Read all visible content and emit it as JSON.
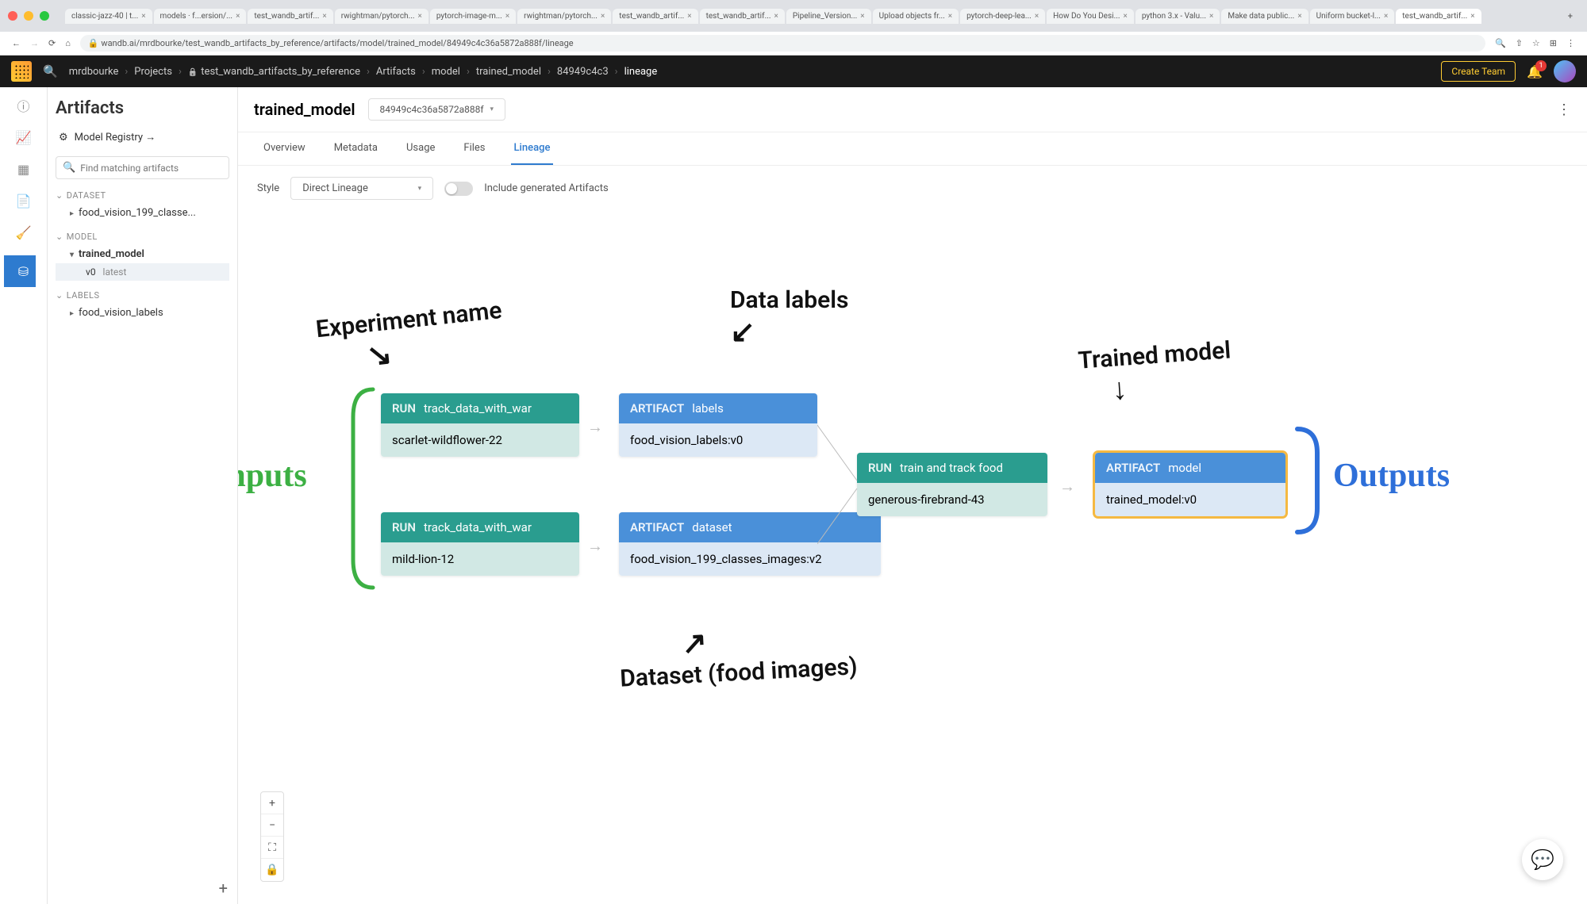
{
  "browser": {
    "tabs": [
      {
        "label": "classic-jazz-40 | t..."
      },
      {
        "label": "models · f...ersion/..."
      },
      {
        "label": "test_wandb_artif..."
      },
      {
        "label": "rwightman/pytorch..."
      },
      {
        "label": "pytorch-image-m..."
      },
      {
        "label": "rwightman/pytorch..."
      },
      {
        "label": "test_wandb_artif..."
      },
      {
        "label": "test_wandb_artif..."
      },
      {
        "label": "Pipeline_Version..."
      },
      {
        "label": "Upload objects fr..."
      },
      {
        "label": "pytorch-deep-lea..."
      },
      {
        "label": "How Do You Desi..."
      },
      {
        "label": "python 3.x - Valu..."
      },
      {
        "label": "Make data public..."
      },
      {
        "label": "Uniform bucket-l..."
      },
      {
        "label": "test_wandb_artif...",
        "active": true
      }
    ],
    "url": "wandb.ai/mrdbourke/test_wandb_artifacts_by_reference/artifacts/model/trained_model/84949c4c36a5872a888f/lineage"
  },
  "header": {
    "crumbs": [
      "mrdbourke",
      "Projects",
      "test_wandb_artifacts_by_reference",
      "Artifacts",
      "model",
      "trained_model",
      "84949c4c3",
      "lineage"
    ],
    "create_team": "Create Team",
    "notif_count": "1"
  },
  "sidebar": {
    "title": "Artifacts",
    "model_registry": "Model Registry →",
    "search_placeholder": "Find matching artifacts",
    "sections": {
      "dataset": {
        "label": "DATASET",
        "items": [
          {
            "name": "food_vision_199_classe..."
          }
        ]
      },
      "model": {
        "label": "MODEL",
        "items": [
          {
            "name": "trained_model",
            "open": true,
            "children": [
              {
                "v": "v0",
                "tag": "latest",
                "selected": true
              }
            ]
          }
        ]
      },
      "labels": {
        "label": "LABELS",
        "items": [
          {
            "name": "food_vision_labels"
          }
        ]
      }
    }
  },
  "main": {
    "title": "trained_model",
    "hash": "84949c4c36a5872a888f",
    "tabs": [
      "Overview",
      "Metadata",
      "Usage",
      "Files",
      "Lineage"
    ],
    "active_tab": "Lineage",
    "style_label": "Style",
    "style_value": "Direct Lineage",
    "include_label": "Include generated Artifacts"
  },
  "lineage": {
    "run1": {
      "tag": "RUN",
      "name": "track_data_with_war",
      "sub": "scarlet-wildflower-22"
    },
    "run2": {
      "tag": "RUN",
      "name": "track_data_with_war",
      "sub": "mild-lion-12"
    },
    "art1": {
      "tag": "ARTIFACT",
      "name": "labels",
      "sub": "food_vision_labels:v0"
    },
    "art2": {
      "tag": "ARTIFACT",
      "name": "dataset",
      "sub": "food_vision_199_classes_images:v2"
    },
    "run3": {
      "tag": "RUN",
      "name": "train and track food",
      "sub": "generous-firebrand-43"
    },
    "art3": {
      "tag": "ARTIFACT",
      "name": "model",
      "sub": "trained_model:v0"
    }
  },
  "annotations": {
    "inputs": "Inputs",
    "outputs": "Outputs",
    "exp_name": "Experiment name",
    "data_labels": "Data labels",
    "trained_model": "Trained model",
    "dataset": "Dataset (food images)"
  }
}
